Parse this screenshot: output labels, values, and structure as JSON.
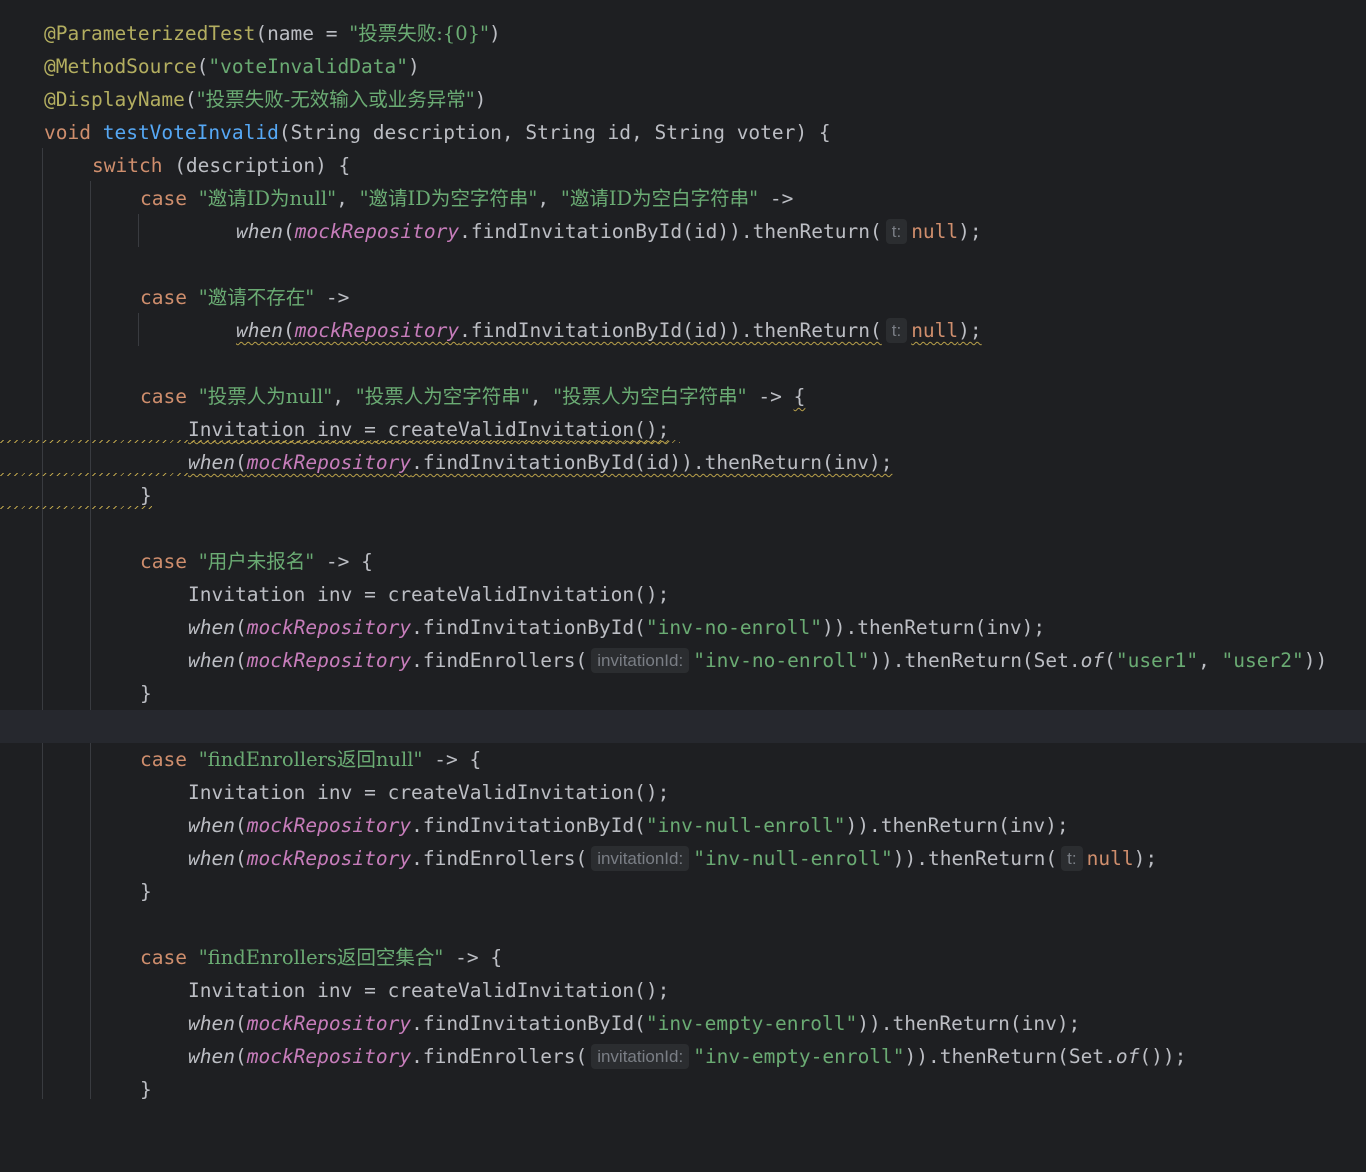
{
  "code": {
    "l1": {
      "ann": "@ParameterizedTest",
      "p1": "(name = ",
      "str": "\"投票失败:{0}\"",
      "p2": ")"
    },
    "l2": {
      "ann": "@MethodSource",
      "p1": "(",
      "str": "\"voteInvalidData\"",
      "p2": ")"
    },
    "l3": {
      "ann": "@DisplayName",
      "p1": "(",
      "str": "\"投票失败-无效输入或业务异常\"",
      "p2": ")"
    },
    "l4": {
      "kw": "void",
      "fn": "testVoteInvalid",
      "params": "(String description, String id, String voter) {"
    },
    "l5": {
      "kw": "switch",
      "rest": " (description) {"
    },
    "l6": {
      "kw": "case",
      "s1": "\"邀请ID为null\"",
      "s2": "\"邀请ID为空字符串\"",
      "s3": "\"邀请ID为空白字符串\"",
      "arrow": " ->"
    },
    "l7": {
      "when": "when",
      "field": "mockRepository",
      "call": ".findInvitationById(id)).thenReturn(",
      "hint": "t:",
      "val": "null",
      "end": ");"
    },
    "l9": {
      "kw": "case",
      "s1": "\"邀请不存在\"",
      "arrow": " ->"
    },
    "l10": {
      "when": "when",
      "field": "mockRepository",
      "call": ".findInvitationById(id)).thenReturn(",
      "hint": "t:",
      "val": "null",
      "end": ");"
    },
    "l12": {
      "kw": "case",
      "s1": "\"投票人为null\"",
      "s2": "\"投票人为空字符串\"",
      "s3": "\"投票人为空白字符串\"",
      "arrow": " -> ",
      "brace": "{"
    },
    "l13": {
      "text": "Invitation inv = createValidInvitation();"
    },
    "l14": {
      "when": "when",
      "field": "mockRepository",
      "call": ".findInvitationById(id)).thenReturn(inv);"
    },
    "l15": {
      "text": "}"
    },
    "l17": {
      "kw": "case",
      "s1": "\"用户未报名\"",
      "arrow": " -> {"
    },
    "l18": {
      "text": "Invitation inv = createValidInvitation();"
    },
    "l19": {
      "when": "when",
      "field": "mockRepository",
      "c1": ".findInvitationById(",
      "s1": "\"inv-no-enroll\"",
      "c2": ")).thenReturn(inv);"
    },
    "l20": {
      "when": "when",
      "field": "mockRepository",
      "c1": ".findEnrollers(",
      "hint": "invitationId:",
      "s1": "\"inv-no-enroll\"",
      "c2": ")).thenReturn(Set.",
      "of": "of",
      "c3": "(",
      "s2": "\"user1\"",
      "c4": ", ",
      "s3": "\"user2\"",
      "c5": "))"
    },
    "l21": {
      "text": "}"
    },
    "l23": {
      "kw": "case",
      "s1": "\"findEnrollers返回null\"",
      "arrow": " -> {"
    },
    "l24": {
      "text": "Invitation inv = createValidInvitation();"
    },
    "l25": {
      "when": "when",
      "field": "mockRepository",
      "c1": ".findInvitationById(",
      "s1": "\"inv-null-enroll\"",
      "c2": ")).thenReturn(inv);"
    },
    "l26": {
      "when": "when",
      "field": "mockRepository",
      "c1": ".findEnrollers(",
      "hint": "invitationId:",
      "s1": "\"inv-null-enroll\"",
      "c2": ")).thenReturn(",
      "hint2": "t:",
      "val": "null",
      "c3": ");"
    },
    "l27": {
      "text": "}"
    },
    "l29": {
      "kw": "case",
      "s1": "\"findEnrollers返回空集合\"",
      "arrow": " -> {"
    },
    "l30": {
      "text": "Invitation inv = createValidInvitation();"
    },
    "l31": {
      "when": "when",
      "field": "mockRepository",
      "c1": ".findInvitationById(",
      "s1": "\"inv-empty-enroll\"",
      "c2": ")).thenReturn(inv);"
    },
    "l32": {
      "when": "when",
      "field": "mockRepository",
      "c1": ".findEnrollers(",
      "hint": "invitationId:",
      "s1": "\"inv-empty-enroll\"",
      "c2": ")).thenReturn(Set.",
      "of": "of",
      "c3": "());"
    },
    "l33": {
      "text": "}"
    }
  }
}
